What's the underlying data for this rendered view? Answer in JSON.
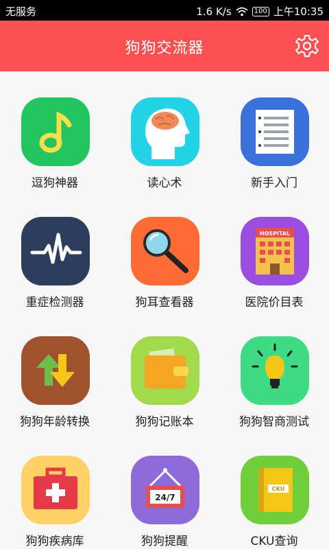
{
  "status_bar": {
    "carrier": "无服务",
    "speed": "1.6 K/s",
    "battery": "100",
    "time": "上午10:35"
  },
  "header": {
    "title": "狗狗交流器"
  },
  "colors": {
    "header_bg": "#fb4f52",
    "background": "#f7f7f7"
  },
  "apps": [
    {
      "label": "逗狗神器",
      "icon": "music-note-icon",
      "color": "#22c55e"
    },
    {
      "label": "读心术",
      "icon": "brain-head-icon",
      "color": "#22d3e6"
    },
    {
      "label": "新手入门",
      "icon": "document-list-icon",
      "color": "#3b6fd9"
    },
    {
      "label": "重症检测器",
      "icon": "heartbeat-icon",
      "color": "#2c3e5c"
    },
    {
      "label": "狗耳查看器",
      "icon": "magnifier-icon",
      "color": "#ff6b35"
    },
    {
      "label": "医院价目表",
      "icon": "hospital-icon",
      "color": "#9b4de0"
    },
    {
      "label": "狗狗年龄转换",
      "icon": "exchange-arrows-icon",
      "color": "#a0522d"
    },
    {
      "label": "狗狗记账本",
      "icon": "wallet-icon",
      "color": "#a3d94d"
    },
    {
      "label": "狗狗智商测试",
      "icon": "lightbulb-icon",
      "color": "#3ddc84"
    },
    {
      "label": "狗狗疾病库",
      "icon": "first-aid-kit-icon",
      "color": "#ffd166"
    },
    {
      "label": "狗狗提醒",
      "icon": "hanging-sign-icon",
      "color": "#8e6bd9"
    },
    {
      "label": "CKU查询",
      "icon": "book-icon",
      "color": "#6fcf3a"
    }
  ],
  "icon_text": {
    "hospital_sign": "HOSPITAL",
    "reminder_sign": "24/7",
    "book_label": "CKU"
  }
}
